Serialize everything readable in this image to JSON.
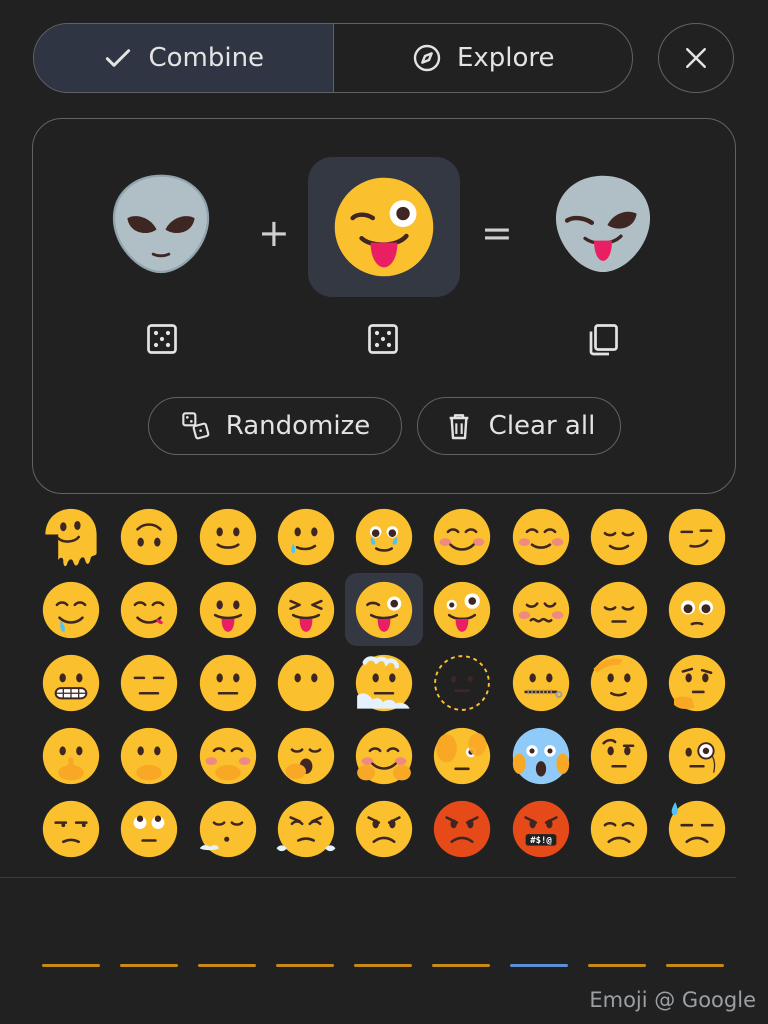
{
  "tabs": {
    "combine": {
      "label": "Combine",
      "icon": "check-icon"
    },
    "explore": {
      "label": "Explore",
      "icon": "compass-icon"
    },
    "close_icon": "close-icon"
  },
  "combiner": {
    "left": {
      "emoji": "alien"
    },
    "plus": "+",
    "right": {
      "emoji": "winking-face-with-tongue"
    },
    "equals": "=",
    "result": {
      "emoji": "alien winking with tongue"
    },
    "randomize_label": "Randomize",
    "clear_label": "Clear all"
  },
  "grid": {
    "rows": [
      [
        "melting-face",
        "upside-down-face",
        "slightly-smiling-face",
        "face-holding-back-tears",
        "smiling-face-with-tear",
        "smiling-face-with-smiling-eyes",
        "smiling-face",
        "relieved-face",
        "smirking-face"
      ],
      [
        "drooling-face",
        "face-savoring-food",
        "face-with-tongue",
        "squinting-face-with-tongue",
        "winking-face-with-tongue",
        "zany-face",
        "woozy-face",
        "pensive-face",
        "pleading-face"
      ],
      [
        "grimacing-face",
        "expressionless-face",
        "neutral-face",
        "face-without-mouth",
        "face-in-clouds",
        "dotted-line-face",
        "zipper-mouth-face",
        "saluting-face",
        "thinking-face"
      ],
      [
        "shushing-face",
        "face-with-hand-over-mouth",
        "smiling-face-with-hand-over-mouth",
        "yawning-face",
        "hugging-face",
        "face-with-peeking-eye",
        "face-screaming-in-fear",
        "face-with-raised-eyebrow",
        "face-with-monocle"
      ],
      [
        "unamused-face",
        "face-with-rolling-eyes",
        "face-exhaling",
        "face-with-steam-from-nose",
        "angry-face",
        "enraged-face",
        "face-with-symbols-on-mouth",
        "disappointed-face",
        "downcast-face-with-sweat"
      ]
    ],
    "selected": "winking-face-with-tongue",
    "cursing_text": "#$!@"
  },
  "footer": "Emoji @ Google",
  "colors": {
    "yellow": "#fbc02d",
    "accent_bg": "#343843",
    "border": "#5f6368"
  }
}
